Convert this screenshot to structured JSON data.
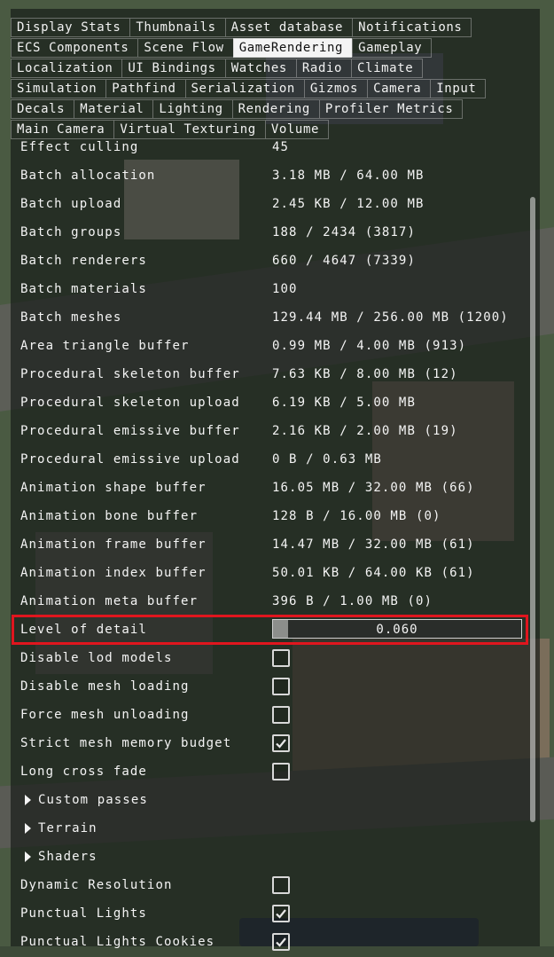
{
  "tabs": [
    [
      "Display Stats",
      "Thumbnails",
      "Asset database",
      "Notifications"
    ],
    [
      "ECS Components",
      "Scene Flow",
      "GameRendering",
      "Gameplay"
    ],
    [
      "Localization",
      "UI Bindings",
      "Watches",
      "Radio",
      "Climate"
    ],
    [
      "Simulation",
      "Pathfind",
      "Serialization",
      "Gizmos",
      "Camera",
      "Input"
    ],
    [
      "Decals",
      "Material",
      "Lighting",
      "Rendering",
      "Profiler Metrics"
    ],
    [
      "Main Camera",
      "Virtual Texturing",
      "Volume"
    ]
  ],
  "active_tab": "GameRendering",
  "stats": [
    {
      "label": "Effect culling",
      "value": "45"
    },
    {
      "label": "Batch allocation",
      "value": "3.18 MB / 64.00 MB"
    },
    {
      "label": "Batch upload",
      "value": "2.45 KB / 12.00 MB"
    },
    {
      "label": "Batch groups",
      "value": "188 / 2434 (3817)"
    },
    {
      "label": "Batch renderers",
      "value": "660 / 4647 (7339)"
    },
    {
      "label": "Batch materials",
      "value": "100"
    },
    {
      "label": "Batch meshes",
      "value": "129.44 MB / 256.00 MB (1200)"
    },
    {
      "label": "Area triangle buffer",
      "value": "0.99 MB / 4.00 MB (913)"
    },
    {
      "label": "Procedural skeleton buffer",
      "value": "7.63 KB / 8.00 MB (12)"
    },
    {
      "label": "Procedural skeleton upload",
      "value": "6.19 KB / 5.00 MB"
    },
    {
      "label": "Procedural emissive buffer",
      "value": "2.16 KB / 2.00 MB (19)"
    },
    {
      "label": "Procedural emissive upload",
      "value": "0 B / 0.63 MB"
    },
    {
      "label": "Animation shape buffer",
      "value": "16.05 MB / 32.00 MB (66)"
    },
    {
      "label": "Animation bone buffer",
      "value": "128 B / 16.00 MB (0)"
    },
    {
      "label": "Animation frame buffer",
      "value": "14.47 MB / 32.00 MB (61)"
    },
    {
      "label": "Animation index buffer",
      "value": "50.01 KB / 64.00 KB (61)"
    },
    {
      "label": "Animation meta buffer",
      "value": "396 B / 1.00 MB (0)"
    }
  ],
  "lod": {
    "label": "Level of detail",
    "value": "0.060",
    "fraction": 0.06
  },
  "toggles": [
    {
      "label": "Disable lod models",
      "checked": false
    },
    {
      "label": "Disable mesh loading",
      "checked": false
    },
    {
      "label": "Force mesh unloading",
      "checked": false
    },
    {
      "label": "Strict mesh memory budget",
      "checked": true
    },
    {
      "label": "Long cross fade",
      "checked": false
    }
  ],
  "folds": [
    "Custom passes",
    "Terrain",
    "Shaders"
  ],
  "toggles2": [
    {
      "label": "Dynamic Resolution",
      "checked": false
    },
    {
      "label": "Punctual Lights",
      "checked": true
    },
    {
      "label": "Punctual Lights Cookies",
      "checked": true
    }
  ],
  "colors": {
    "highlight": "#e0161e",
    "active_tab_bg": "#f4f4f4"
  }
}
